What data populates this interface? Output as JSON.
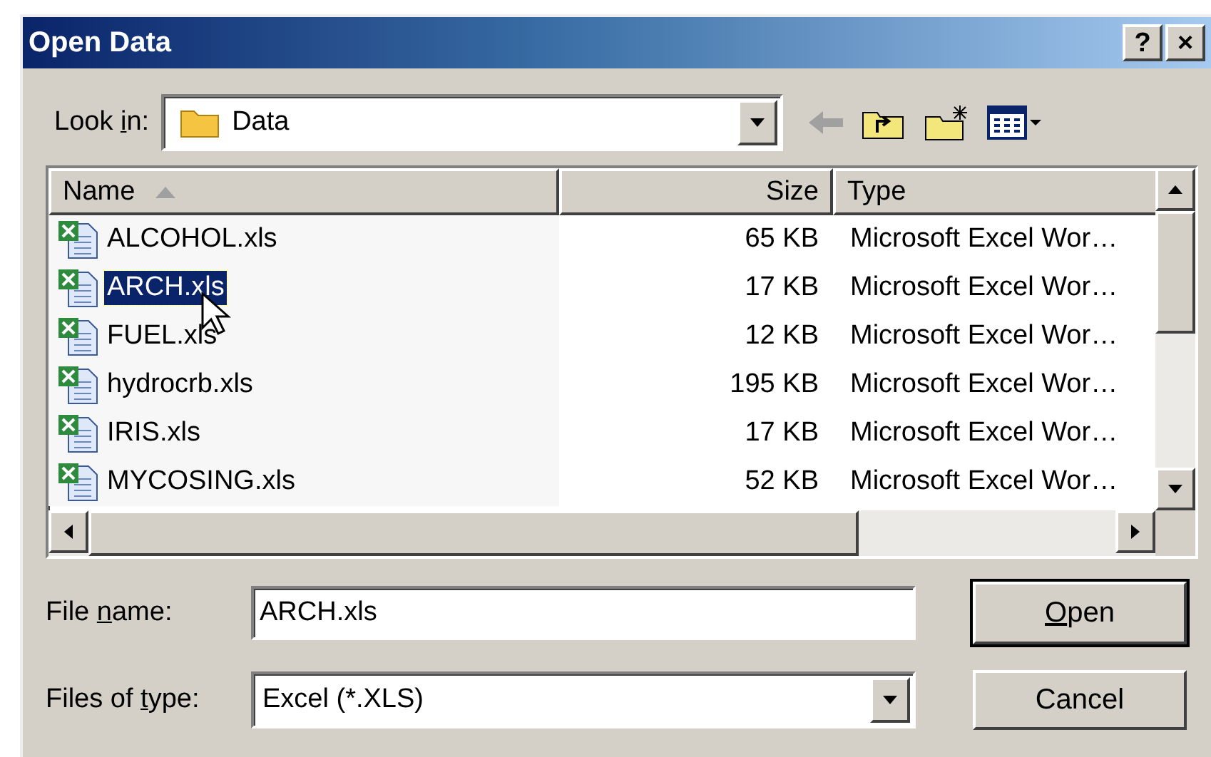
{
  "window": {
    "title": "Open Data",
    "title_buttons": [
      "?",
      "×"
    ]
  },
  "look_in": {
    "label_parts": [
      {
        "text": "Look ",
        "underlined": false
      },
      {
        "text": "i",
        "underlined": true
      },
      {
        "text": "n:",
        "underlined": false
      }
    ],
    "value": "Data"
  },
  "toolbar": [
    {
      "kind": "back",
      "disabled": true
    },
    {
      "kind": "up",
      "disabled": false
    },
    {
      "kind": "new-folder",
      "disabled": false
    },
    {
      "kind": "view-menu",
      "disabled": false
    }
  ],
  "file_list": {
    "columns": [
      {
        "label": "Name",
        "sorted": true
      },
      {
        "label": "Size",
        "sorted": false
      },
      {
        "label": "Type",
        "sorted": false
      }
    ],
    "rows": [
      {
        "name": "ALCOHOL.xls",
        "size": "65 KB",
        "type": "Microsoft Excel Wor…",
        "selected": false
      },
      {
        "name": "ARCH.xls",
        "size": "17 KB",
        "type": "Microsoft Excel Wor…",
        "selected": true
      },
      {
        "name": "FUEL.xls",
        "size": "12 KB",
        "type": "Microsoft Excel Wor…",
        "selected": false
      },
      {
        "name": "hydrocrb.xls",
        "size": "195 KB",
        "type": "Microsoft Excel Wor…",
        "selected": false
      },
      {
        "name": "IRIS.xls",
        "size": "17 KB",
        "type": "Microsoft Excel Wor…",
        "selected": false
      },
      {
        "name": "MYCOSING.xls",
        "size": "52 KB",
        "type": "Microsoft Excel Wor…",
        "selected": false
      }
    ]
  },
  "file_name": {
    "label_parts": [
      {
        "text": "File ",
        "underlined": false
      },
      {
        "text": "n",
        "underlined": true
      },
      {
        "text": "ame:",
        "underlined": false
      }
    ],
    "value": "ARCH.xls"
  },
  "file_type": {
    "label_parts": [
      {
        "text": "Files of ",
        "underlined": false
      },
      {
        "text": "t",
        "underlined": true
      },
      {
        "text": "ype:",
        "underlined": false
      }
    ],
    "value": "Excel (*.XLS)"
  },
  "buttons": [
    {
      "label_parts": [
        {
          "text": "O",
          "underlined": true
        },
        {
          "text": "pen",
          "underlined": false
        }
      ],
      "default": true
    },
    {
      "label_parts": [
        {
          "text": "Cancel",
          "underlined": false
        }
      ],
      "default": false
    }
  ]
}
